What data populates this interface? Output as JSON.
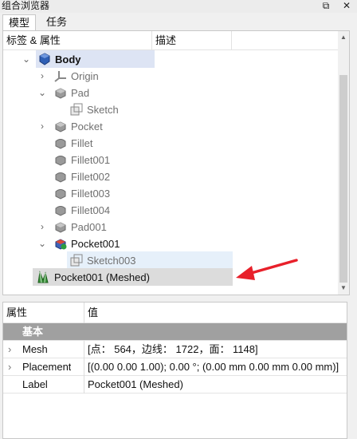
{
  "window": {
    "title": "组合浏览器"
  },
  "tabs": [
    {
      "label": "模型",
      "active": true
    },
    {
      "label": "任务",
      "active": false
    }
  ],
  "tree": {
    "columns": {
      "labels": "标签 & 属性",
      "description": "描述"
    },
    "items": [
      {
        "label": "Body",
        "icon": "body-icon"
      },
      {
        "label": "Origin",
        "icon": "origin-icon"
      },
      {
        "label": "Pad",
        "icon": "pad-icon"
      },
      {
        "label": "Sketch",
        "icon": "sketch-icon"
      },
      {
        "label": "Pocket",
        "icon": "pocket-icon"
      },
      {
        "label": "Fillet",
        "icon": "fillet-icon"
      },
      {
        "label": "Fillet001",
        "icon": "fillet-icon"
      },
      {
        "label": "Fillet002",
        "icon": "fillet-icon"
      },
      {
        "label": "Fillet003",
        "icon": "fillet-icon"
      },
      {
        "label": "Fillet004",
        "icon": "fillet-icon"
      },
      {
        "label": "Pad001",
        "icon": "pad-icon"
      },
      {
        "label": "Pocket001",
        "icon": "pocket-tip-icon"
      },
      {
        "label": "Sketch003",
        "icon": "sketch-icon"
      },
      {
        "label": "Pocket001 (Meshed)",
        "icon": "mesh-icon"
      }
    ]
  },
  "properties": {
    "columns": {
      "property": "属性",
      "value": "值"
    },
    "group": "基本",
    "rows": [
      {
        "name": "Mesh",
        "value": "[点： 564，边线： 1722，面： 1148]",
        "expandable": true
      },
      {
        "name": "Placement",
        "value": "[(0.00 0.00 1.00); 0.00 °; (0.00 mm  0.00 mm  0.00 mm)]",
        "expandable": true
      },
      {
        "name": "Label",
        "value": "Pocket001 (Meshed)",
        "expandable": false
      }
    ]
  },
  "colors": {
    "annotation_arrow": "#e8202a",
    "selection": "#dde4f4",
    "group_header": "#a0a0a0"
  }
}
